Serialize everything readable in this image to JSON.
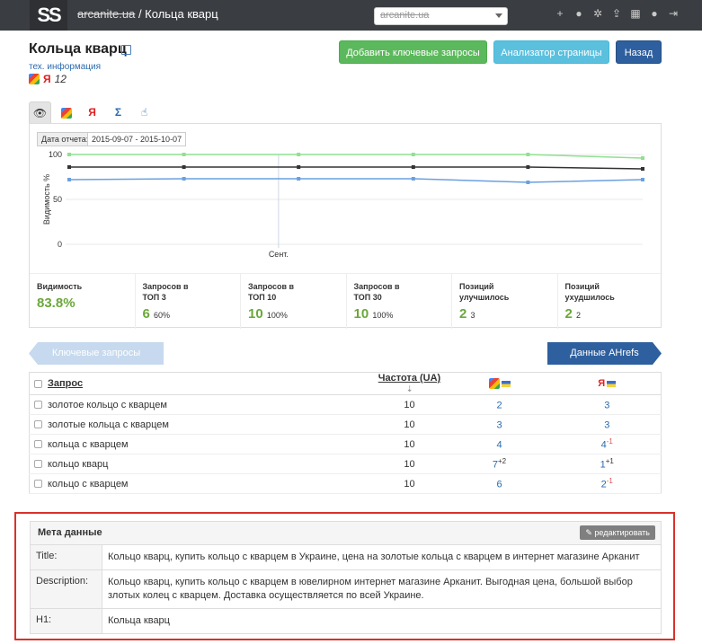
{
  "topbar": {
    "logo": "SS",
    "breadcrumb_site": "arcanite.ua",
    "breadcrumb_sep": " / ",
    "breadcrumb_page": "Кольца кварц",
    "site_select_value": "arcanite.ua",
    "icons": [
      "plus-icon",
      "info-icon",
      "gears-icon",
      "upload-icon",
      "grid-icon",
      "user-icon",
      "logout-icon"
    ]
  },
  "header": {
    "title": "Кольца кварц",
    "tech_link": "тех. информация",
    "yandex_letter": "Я",
    "count": "12",
    "add_keywords": "Добавить ключевые запросы",
    "page_analyzer": "Анализатор страницы",
    "back": "Назад"
  },
  "tabs": {
    "items": [
      "eye-icon",
      "google-icon",
      "yandex-icon",
      "sigma-icon",
      "pointer-icon"
    ],
    "yandex": "Я",
    "sigma": "Σ"
  },
  "report": {
    "date_label": "Дата отчета:",
    "date_range": "2015-09-07 - 2015-10-07"
  },
  "chart_data": {
    "type": "line",
    "ylabel": "Видимость %",
    "ylim": [
      0,
      100
    ],
    "yticks": [
      0,
      50,
      100
    ],
    "x_label": "Сент.",
    "x": [
      0,
      1,
      2,
      3,
      4,
      5
    ],
    "series": [
      {
        "color": "#90e090",
        "values": [
          100,
          100,
          100,
          100,
          100,
          96
        ]
      },
      {
        "color": "#333333",
        "values": [
          86,
          86,
          86,
          86,
          86,
          84
        ]
      },
      {
        "color": "#6aa0e0",
        "values": [
          72,
          73,
          73,
          73,
          69,
          72
        ]
      }
    ]
  },
  "kpis": [
    {
      "label1": "Видимость",
      "label2": "",
      "value": "83.8%",
      "sub": ""
    },
    {
      "label1": "Запросов в",
      "label2": "ТОП 3",
      "value": "6",
      "sub": "60%"
    },
    {
      "label1": "Запросов в",
      "label2": "ТОП 10",
      "value": "10",
      "sub": "100%"
    },
    {
      "label1": "Запросов в",
      "label2": "ТОП 30",
      "value": "10",
      "sub": "100%"
    },
    {
      "label1": "Позиций",
      "label2": "улучшилось",
      "value": "2",
      "sub": "3"
    },
    {
      "label1": "Позиций",
      "label2": "ухудшилось",
      "value": "2",
      "sub": "2"
    }
  ],
  "nav": {
    "keywords": "Ключевые запросы",
    "ahrefs": "Данные AHrefs"
  },
  "table": {
    "col_query": "Запрос",
    "col_freq": "Частота (UA)",
    "yandex_letter": "Я",
    "rows": [
      {
        "query": "золотое кольцо с кварцем",
        "freq": "10",
        "google": "2",
        "g_delta": "",
        "yandex": "3",
        "y_delta": ""
      },
      {
        "query": "золотые кольца с кварцем",
        "freq": "10",
        "google": "3",
        "g_delta": "",
        "yandex": "3",
        "y_delta": ""
      },
      {
        "query": "кольца с кварцем",
        "freq": "10",
        "google": "4",
        "g_delta": "",
        "yandex": "4",
        "y_delta": "-1"
      },
      {
        "query": "кольцо кварц",
        "freq": "10",
        "google": "7",
        "g_delta": "+2",
        "yandex": "1",
        "y_delta": "+1"
      },
      {
        "query": "кольцо с кварцем",
        "freq": "10",
        "google": "6",
        "g_delta": "",
        "yandex": "2",
        "y_delta": "-1"
      }
    ]
  },
  "meta": {
    "heading": "Мета данные",
    "edit": "редактировать",
    "title_key": "Title:",
    "title_val": "Кольцо кварц, купить кольцо с кварцем в Украине, цена на золотые кольца с кварцем в интернет магазине Арканит",
    "desc_key": "Description:",
    "desc_val": "Кольцо кварц, купить кольцо с кварцем в ювелирном интернет магазине Арканит. Выгодная цена, большой выбор злотых колец с кварцем. Доставка осуществляется по всей Украине.",
    "h1_key": "H1:",
    "h1_val": "Кольца кварц"
  }
}
